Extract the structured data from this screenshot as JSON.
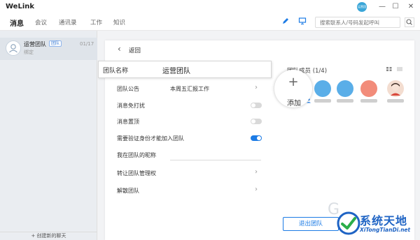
{
  "app": {
    "name": "WeLink",
    "avatar_text": "运营团"
  },
  "window_controls": {
    "minimize": "—",
    "maximize": "☐",
    "close": "✕"
  },
  "nav": {
    "tabs": [
      "消息",
      "会议",
      "通讯录",
      "工作",
      "知识"
    ],
    "search_placeholder": "搜索联系人/号码发起呼叫"
  },
  "sidebar": {
    "conversation": {
      "title": "运营团队",
      "badge": "团队",
      "subtitle": "绑定",
      "date": "01/17"
    },
    "new_chat": "+ 创建新的聊天"
  },
  "detail": {
    "back_label": "返回",
    "team_name_label": "团队名称",
    "team_name_value": "运营团队",
    "rows": {
      "announcement_label": "团队公告",
      "announcement_value": "本周五汇报工作",
      "dnd_label": "消息免打扰",
      "dnd_on": false,
      "pin_label": "消息置顶",
      "pin_on": false,
      "verify_label": "需要验证身份才能加入团队",
      "verify_on": true,
      "nickname_label": "我在团队的昵称",
      "transfer_label": "转让团队管理权",
      "dissolve_label": "解散团队"
    },
    "members": {
      "title": "团队成员 (1/4)",
      "add_label": "添加"
    },
    "exit_button": "退出团队"
  },
  "watermark": {
    "text": "系统天地",
    "sub": "XiTongTianDi.net"
  },
  "colors": {
    "accent": "#1c7be5",
    "toggle_off": "#d9d9d9"
  }
}
